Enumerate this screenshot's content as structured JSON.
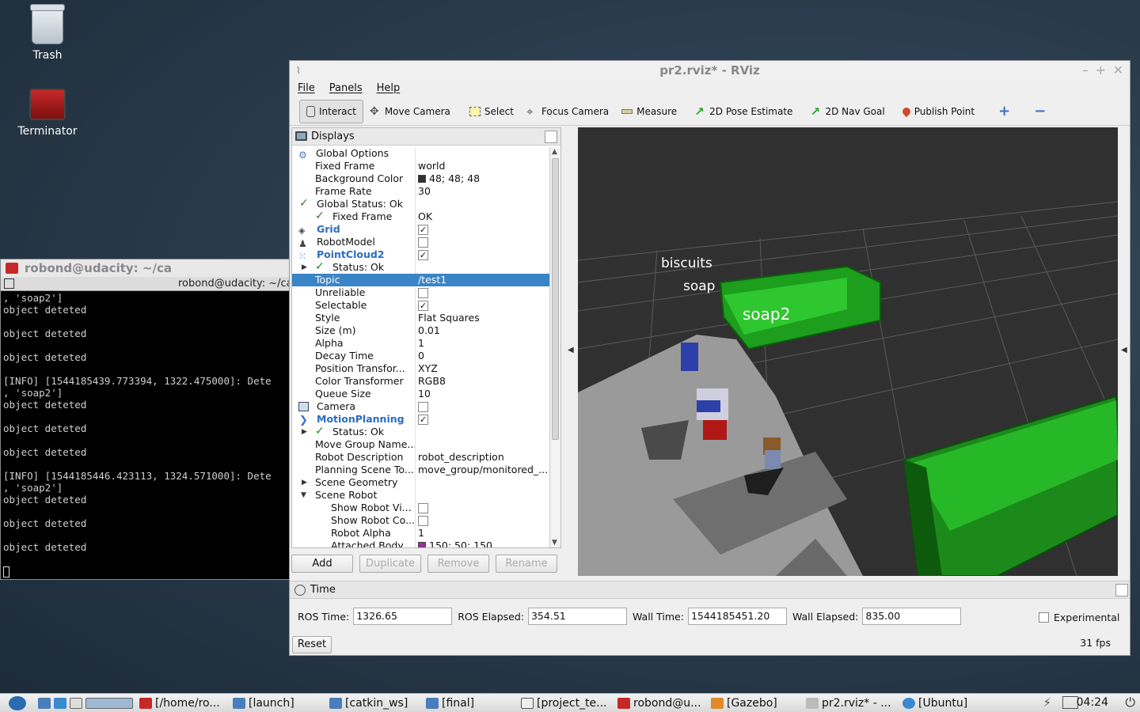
{
  "desktop": {
    "icons": [
      {
        "label": "Trash"
      },
      {
        "label": "Terminator"
      }
    ]
  },
  "terminal": {
    "title": "robond@udacity: ~/ca",
    "tab_title": "robond@udacity: ~/ca",
    "lines": [
      ", 'soap2']",
      "object deteted",
      "",
      "object deteted",
      "",
      "object deteted",
      "",
      "[INFO] [1544185439.773394, 1322.475000]: Dete",
      ", 'soap2']",
      "object deteted",
      "",
      "object deteted",
      "",
      "object deteted",
      "",
      "[INFO] [1544185446.423113, 1324.571000]: Dete",
      ", 'soap2']",
      "object deteted",
      "",
      "object deteted",
      "",
      "object deteted"
    ]
  },
  "rviz": {
    "title": "pr2.rviz* - RViz",
    "menu": [
      "File",
      "Panels",
      "Help"
    ],
    "toolbar": [
      {
        "label": "Interact",
        "icon": "cursor-icon"
      },
      {
        "label": "Move Camera",
        "icon": "move-icon"
      },
      {
        "label": "Select",
        "icon": "select-icon"
      },
      {
        "label": "Focus Camera",
        "icon": "focus-icon"
      },
      {
        "label": "Measure",
        "icon": "ruler-icon"
      },
      {
        "label": "2D Pose Estimate",
        "icon": "green-arrow-icon"
      },
      {
        "label": "2D Nav Goal",
        "icon": "green-arrow-icon"
      },
      {
        "label": "Publish Point",
        "icon": "pin-icon"
      }
    ],
    "displays": {
      "header": "Displays",
      "rows": [
        {
          "name": "Global Options",
          "value": ""
        },
        {
          "name": "Fixed Frame",
          "value": "world"
        },
        {
          "name": "Background Color",
          "value": "48; 48; 48"
        },
        {
          "name": "Frame Rate",
          "value": "30"
        },
        {
          "name": "Global Status: Ok",
          "value": ""
        },
        {
          "name": "Fixed Frame",
          "value": "OK"
        },
        {
          "name": "Grid",
          "value": ""
        },
        {
          "name": "RobotModel",
          "value": ""
        },
        {
          "name": "PointCloud2",
          "value": ""
        },
        {
          "name": "Status: Ok",
          "value": ""
        },
        {
          "name": "Topic",
          "value": "/test1"
        },
        {
          "name": "Unreliable",
          "value": ""
        },
        {
          "name": "Selectable",
          "value": ""
        },
        {
          "name": "Style",
          "value": "Flat Squares"
        },
        {
          "name": "Size (m)",
          "value": "0.01"
        },
        {
          "name": "Alpha",
          "value": "1"
        },
        {
          "name": "Decay Time",
          "value": "0"
        },
        {
          "name": "Position Transfor...",
          "value": "XYZ"
        },
        {
          "name": "Color Transformer",
          "value": "RGB8"
        },
        {
          "name": "Queue Size",
          "value": "10"
        },
        {
          "name": "Camera",
          "value": ""
        },
        {
          "name": "MotionPlanning",
          "value": ""
        },
        {
          "name": "Status: Ok",
          "value": ""
        },
        {
          "name": "Move Group Name...",
          "value": ""
        },
        {
          "name": "Robot Description",
          "value": "robot_description"
        },
        {
          "name": "Planning Scene To...",
          "value": "move_group/monitored_..."
        },
        {
          "name": "Scene Geometry",
          "value": ""
        },
        {
          "name": "Scene Robot",
          "value": ""
        },
        {
          "name": "Show Robot Vi...",
          "value": ""
        },
        {
          "name": "Show Robot Co...",
          "value": ""
        },
        {
          "name": "Robot Alpha",
          "value": "1"
        },
        {
          "name": "Attached Body...",
          "value": "150; 50; 150"
        }
      ],
      "buttons": [
        "Add",
        "Duplicate",
        "Remove",
        "Rename"
      ]
    },
    "scene_labels": [
      "biscuits",
      "soap",
      "soap2"
    ],
    "time": {
      "header": "Time",
      "ros_time_label": "ROS Time:",
      "ros_time": "1326.65",
      "ros_elapsed_label": "ROS Elapsed:",
      "ros_elapsed": "354.51",
      "wall_time_label": "Wall Time:",
      "wall_time": "1544185451.20",
      "wall_elapsed_label": "Wall Elapsed:",
      "wall_elapsed": "835.00",
      "experimental": "Experimental",
      "reset": "Reset",
      "fps": "31 fps"
    }
  },
  "taskbar": {
    "items": [
      "[/home/ro...",
      "[launch]",
      "[catkin_ws]",
      "[final]",
      "[project_te...",
      "robond@u...",
      "[Gazebo]",
      "pr2.rviz* - ...",
      "[Ubuntu]"
    ],
    "clock": "04:24"
  },
  "colors": {
    "selection": "#3a84c8",
    "viewport_bg": "#303030",
    "bg_swatch": "#303030",
    "attached_swatch": "#963296"
  }
}
